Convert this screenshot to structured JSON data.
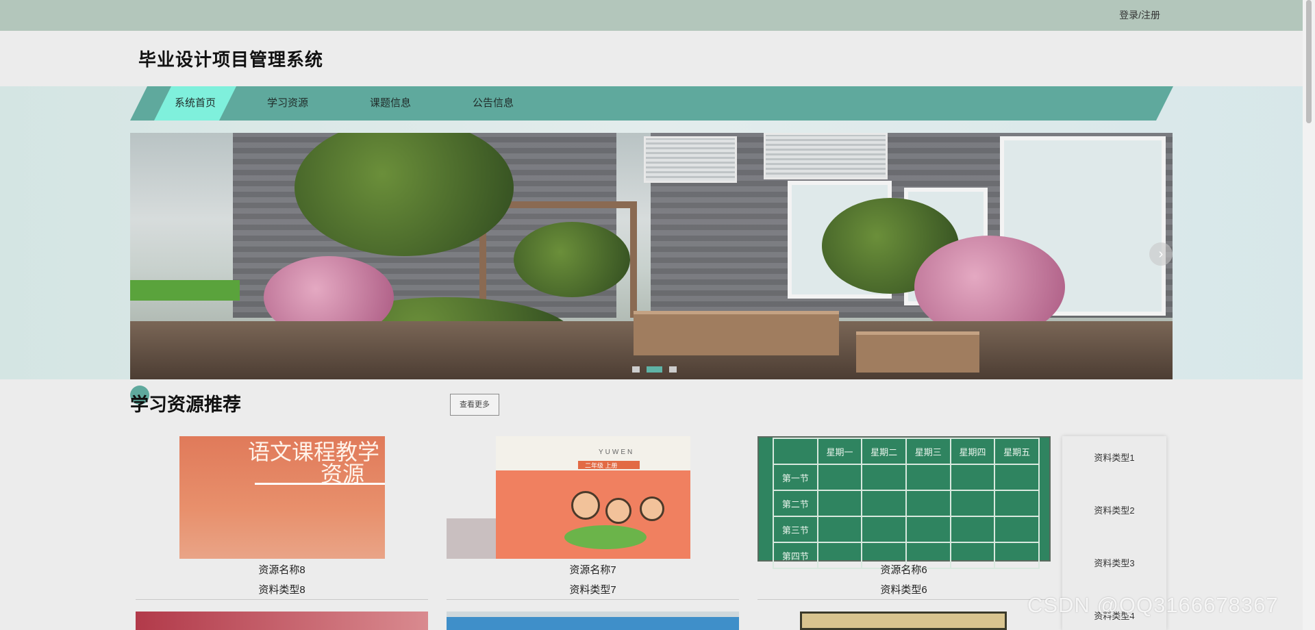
{
  "topbar": {
    "login_link": "登录/注册"
  },
  "header": {
    "site_title": "毕业设计项目管理系统"
  },
  "nav": {
    "items": [
      {
        "label": "系统首页",
        "active": true
      },
      {
        "label": "学习资源",
        "active": false
      },
      {
        "label": "课题信息",
        "active": false
      },
      {
        "label": "公告信息",
        "active": false
      }
    ]
  },
  "carousel": {
    "slide_count": 3,
    "active_slide": 2
  },
  "section": {
    "title": "学习资源推荐",
    "more_label": "查看更多"
  },
  "resources": [
    {
      "name": "资源名称8",
      "type": "资料类型8",
      "cover_text": [
        "语文课程教学",
        "资源"
      ]
    },
    {
      "name": "资源名称7",
      "type": "资料类型7",
      "cover_text": [
        "YUWEN",
        "二年级 上册"
      ]
    },
    {
      "name": "资源名称6",
      "type": "资料类型6",
      "cover_text": [
        "星期一",
        "星期二",
        "星期三",
        "星期四",
        "星期五",
        "第一节",
        "第二节",
        "第三节",
        "第四节"
      ]
    }
  ],
  "sidebar": {
    "categories": [
      "资料类型1",
      "资料类型2",
      "资料类型3",
      "资料类型4"
    ]
  },
  "watermark": "CSDN @QQ3166678367",
  "colors": {
    "topbar": "#b3c6bb",
    "nav": "#5fa99d",
    "nav_active": "#7ff0dc",
    "carousel_active_dot": "#5fb3a6"
  }
}
